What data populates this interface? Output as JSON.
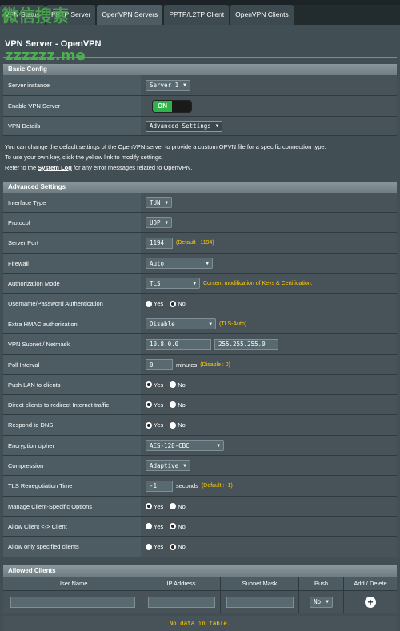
{
  "tabs": [
    {
      "label": "VPN Status"
    },
    {
      "label": "PPTP Server"
    },
    {
      "label": "OpenVPN Servers"
    },
    {
      "label": "PPTP/L2TP Client"
    },
    {
      "label": "OpenVPN Clients"
    }
  ],
  "watermark": {
    "top": "微信搜索",
    "bottom": "zzzzzz.me"
  },
  "page_title": "VPN Server - OpenVPN",
  "basic": {
    "header": "Basic Config",
    "server_instance_label": "Server instance",
    "server_instance_value": "Server 1",
    "enable_label": "Enable VPN Server",
    "enable_value": "ON",
    "details_label": "VPN Details",
    "details_value": "Advanced Settings"
  },
  "info": {
    "line1": "You can change the default settings of the OpenVPN server to provide a custom OPVN file for a specific connection type.",
    "line2": "To use your own key, click the yellow link to modify settings.",
    "line3_pre": "Refer to the",
    "line3_link": "System Log",
    "line3_post": "for any error messages related to OpenVPN."
  },
  "advanced": {
    "header": "Advanced Settings",
    "interface_type_label": "Interface Type",
    "interface_type_value": "TUN",
    "protocol_label": "Protocol",
    "protocol_value": "UDP",
    "port_label": "Server Port",
    "port_value": "1194",
    "port_hint": "(Default : 1194)",
    "firewall_label": "Firewall",
    "firewall_value": "Auto",
    "auth_mode_label": "Authorization Mode",
    "auth_mode_value": "TLS",
    "auth_mode_link": "Content modification of Keys & Certification.",
    "userpass_label": "Username/Password Authentication",
    "hmac_label": "Extra HMAC authorization",
    "hmac_value": "Disable",
    "hmac_hint": "(TLS-Auth)",
    "subnet_label": "VPN Subnet / Netmask",
    "subnet_value": "10.8.0.0",
    "netmask_value": "255.255.255.0",
    "poll_label": "Poll Interval",
    "poll_value": "0",
    "poll_unit": "minutes",
    "poll_hint": "(Disable : 0)",
    "push_lan_label": "Push LAN to clients",
    "redirect_label": "Direct clients to redirect Internet traffic",
    "dns_label": "Respond to DNS",
    "cipher_label": "Encryption cipher",
    "cipher_value": "AES-128-CBC",
    "compression_label": "Compression",
    "compression_value": "Adaptive",
    "tls_reneg_label": "TLS Renegotiation Time",
    "tls_reneg_value": "-1",
    "tls_reneg_unit": "seconds",
    "tls_reneg_hint": "(Default : -1)",
    "manage_label": "Manage Client-Specific Options",
    "c2c_label": "Allow Client <-> Client",
    "only_spec_label": "Allow only specified clients",
    "yes": "Yes",
    "no": "No"
  },
  "radios": {
    "userpass": "no",
    "push_lan": "yes",
    "redirect": "yes",
    "dns": "yes",
    "manage": "yes",
    "c2c": "no",
    "only_spec": "no"
  },
  "clients": {
    "header": "Allowed Clients",
    "col_user": "User Name",
    "col_ip": "IP Address",
    "col_mask": "Subnet Mask",
    "col_push": "Push",
    "col_add": "Add / Delete",
    "push_value": "No",
    "add_icon": "+",
    "empty": "No data in table."
  }
}
